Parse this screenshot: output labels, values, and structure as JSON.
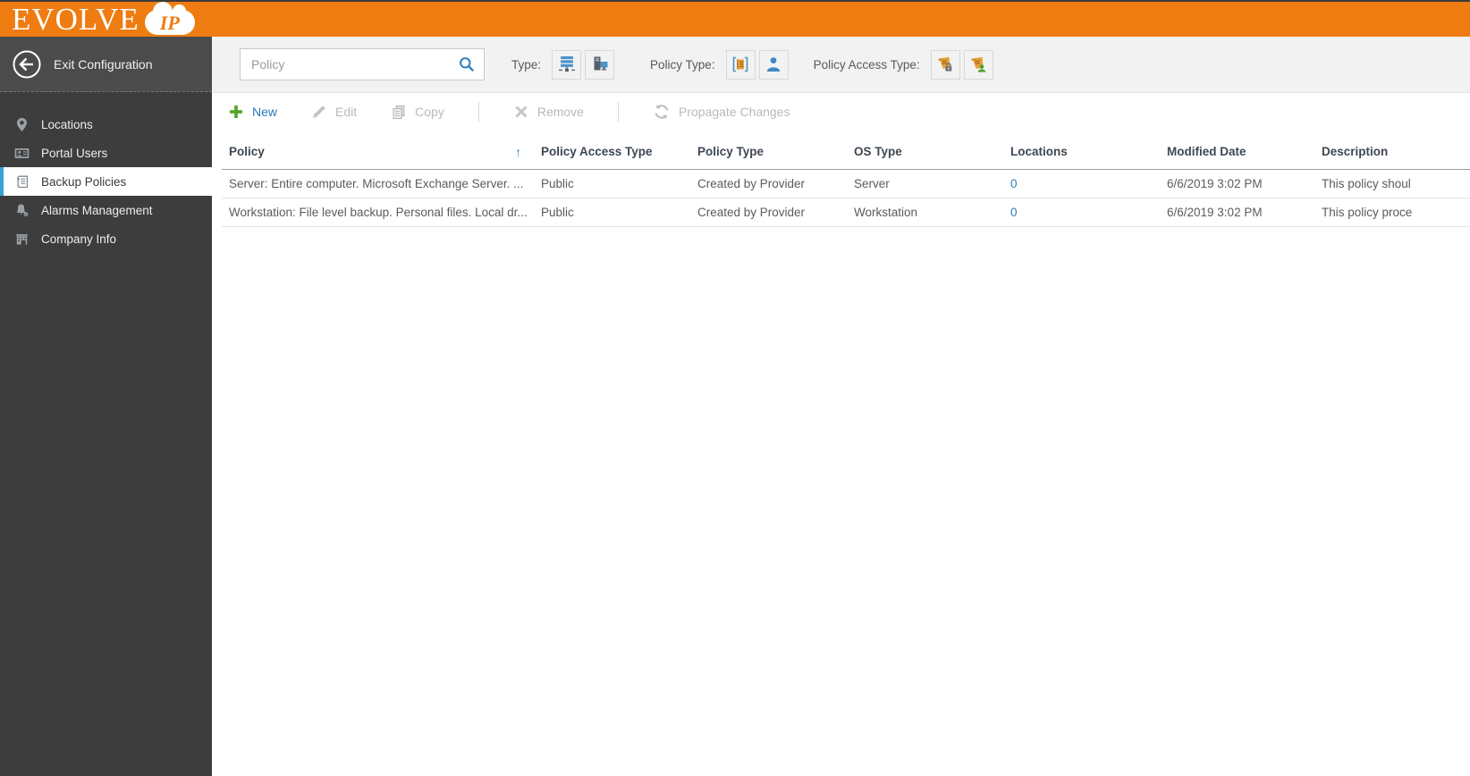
{
  "logo": {
    "text": "EVOLVE",
    "badge": "IP"
  },
  "sidebar": {
    "exit": {
      "label": "Exit Configuration"
    },
    "items": [
      {
        "label": "Locations",
        "icon": "location-pin-icon",
        "selected": false
      },
      {
        "label": "Portal Users",
        "icon": "portal-users-icon",
        "selected": false
      },
      {
        "label": "Backup Policies",
        "icon": "backup-policies-icon",
        "selected": true
      },
      {
        "label": "Alarms Management",
        "icon": "alarms-icon",
        "selected": false
      },
      {
        "label": "Company Info",
        "icon": "company-info-icon",
        "selected": false
      }
    ]
  },
  "filters": {
    "search_placeholder": "Policy",
    "type_label": "Type:",
    "type_options": [
      "server",
      "workstation"
    ],
    "policy_type_label": "Policy Type:",
    "policy_type_options": [
      "provider-policy",
      "user-policy"
    ],
    "policy_access_type_label": "Policy Access Type:",
    "policy_access_type_options": [
      "private-access",
      "public-access"
    ]
  },
  "toolbar": {
    "new": "New",
    "edit": "Edit",
    "copy": "Copy",
    "remove": "Remove",
    "propagate": "Propagate Changes"
  },
  "table": {
    "columns": [
      "Policy",
      "Policy Access Type",
      "Policy Type",
      "OS Type",
      "Locations",
      "Modified Date",
      "Description"
    ],
    "sort": {
      "column": "Policy",
      "direction": "ascending",
      "arrow": "↑"
    },
    "rows": [
      {
        "policy": "Server: Entire computer. Microsoft Exchange Server. ...",
        "access": "Public",
        "type": "Created by Provider",
        "os": "Server",
        "locations": "0",
        "modified": "6/6/2019 3:02 PM",
        "description": "This policy shoul"
      },
      {
        "policy": "Workstation: File level backup. Personal files. Local dr...",
        "access": "Public",
        "type": "Created by Provider",
        "os": "Workstation",
        "locations": "0",
        "modified": "6/6/2019 3:02 PM",
        "description": "This policy proce"
      }
    ]
  },
  "colors": {
    "brand_orange": "#EE7C11",
    "sidebar_dark": "#3D3D3D",
    "sidebar_exit_bg": "#4B4B4B",
    "selected_accent_blue": "#35A3D5",
    "link_blue": "#2E7DB2",
    "action_blue": "#2878B8",
    "action_green": "#52A427",
    "icon_blue": "#4B93C9",
    "icon_orange": "#EAA23B",
    "icon_green": "#4CA32A",
    "disabled_gray": "#B9B9B9"
  }
}
